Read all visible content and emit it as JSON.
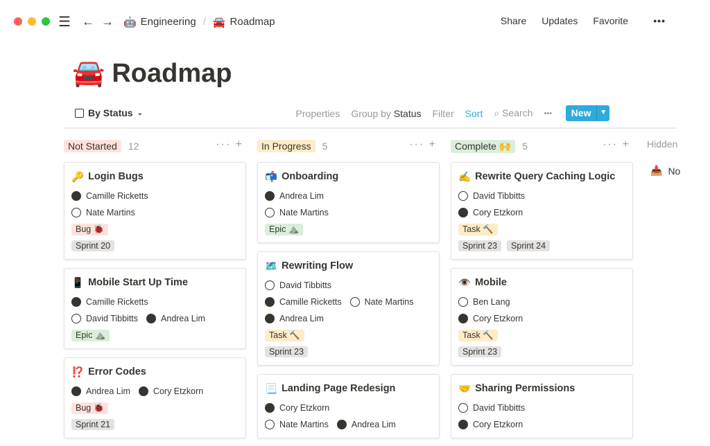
{
  "window": {
    "lights": [
      "#ff5f57",
      "#febc2e",
      "#28c840"
    ]
  },
  "breadcrumb": [
    {
      "icon": "🤖",
      "label": "Engineering"
    },
    {
      "icon": "🚘",
      "label": "Roadmap"
    }
  ],
  "topbar": {
    "share": "Share",
    "updates": "Updates",
    "favorite": "Favorite",
    "more": "•••"
  },
  "page": {
    "icon": "🚘",
    "title": "Roadmap"
  },
  "toolbar": {
    "view": "By Status",
    "properties": "Properties",
    "group_by": "Group by",
    "group_value": "Status",
    "filter": "Filter",
    "sort": "Sort",
    "search": "Search",
    "more": "•••",
    "new": "New"
  },
  "colors": {
    "accent": "#2eaadc"
  },
  "columns": [
    {
      "label": "Not Started",
      "count": "12",
      "color": "#ffe2dd",
      "cards": [
        {
          "icon": "🔑",
          "title": "Login Bugs",
          "rows": [
            [
              "Camille Ricketts"
            ],
            [
              "Nate Martins"
            ]
          ],
          "type": {
            "label": "Bug 🐞",
            "color": "#ffe2dd"
          },
          "sprints": [
            "Sprint 20"
          ]
        },
        {
          "icon": "📱",
          "title": "Mobile Start Up Time",
          "rows": [
            [
              "Camille Ricketts"
            ],
            [
              "David Tibbitts",
              "Andrea Lim"
            ]
          ],
          "type": {
            "label": "Epic ⛰️",
            "color": "#dbeddb"
          },
          "sprints": []
        },
        {
          "icon": "⁉️",
          "title": "Error Codes",
          "rows": [
            [
              "Andrea Lim",
              "Cory Etzkorn"
            ]
          ],
          "type": {
            "label": "Bug 🐞",
            "color": "#ffe2dd"
          },
          "sprints": [
            "Sprint 21"
          ]
        }
      ]
    },
    {
      "label": "In Progress",
      "count": "5",
      "color": "#fdecc8",
      "cards": [
        {
          "icon": "📬",
          "title": "Onboarding",
          "rows": [
            [
              "Andrea Lim"
            ],
            [
              "Nate Martins"
            ]
          ],
          "type": {
            "label": "Epic ⛰️",
            "color": "#dbeddb"
          },
          "sprints": []
        },
        {
          "icon": "🗺️",
          "title": "Rewriting Flow",
          "rows": [
            [
              "David Tibbitts"
            ],
            [
              "Camille Ricketts",
              "Nate Martins"
            ],
            [
              "Andrea Lim"
            ]
          ],
          "type": {
            "label": "Task 🔨",
            "color": "#fdecc8"
          },
          "sprints": [
            "Sprint 23"
          ]
        },
        {
          "icon": "📃",
          "title": "Landing Page Redesign",
          "rows": [
            [
              "Cory Etzkorn"
            ],
            [
              "Nate Martins",
              "Andrea Lim"
            ]
          ],
          "type": null,
          "sprints": []
        }
      ]
    },
    {
      "label": "Complete 🙌",
      "count": "5",
      "color": "#dbeddb",
      "cards": [
        {
          "icon": "✍️",
          "title": "Rewrite Query Caching Logic",
          "rows": [
            [
              "David Tibbitts"
            ],
            [
              "Cory Etzkorn"
            ]
          ],
          "type": {
            "label": "Task 🔨",
            "color": "#fdecc8"
          },
          "sprints": [
            "Sprint 23",
            "Sprint 24"
          ]
        },
        {
          "icon": "👁️",
          "title": "Mobile",
          "rows": [
            [
              "Ben Lang"
            ],
            [
              "Cory Etzkorn"
            ]
          ],
          "type": {
            "label": "Task 🔨",
            "color": "#fdecc8"
          },
          "sprints": [
            "Sprint 23"
          ]
        },
        {
          "icon": "🤝",
          "title": "Sharing Permissions",
          "rows": [
            [
              "David Tibbitts"
            ],
            [
              "Cory Etzkorn"
            ]
          ],
          "type": null,
          "sprints": []
        }
      ]
    }
  ],
  "hidden": {
    "label": "Hidden",
    "item": "No"
  }
}
